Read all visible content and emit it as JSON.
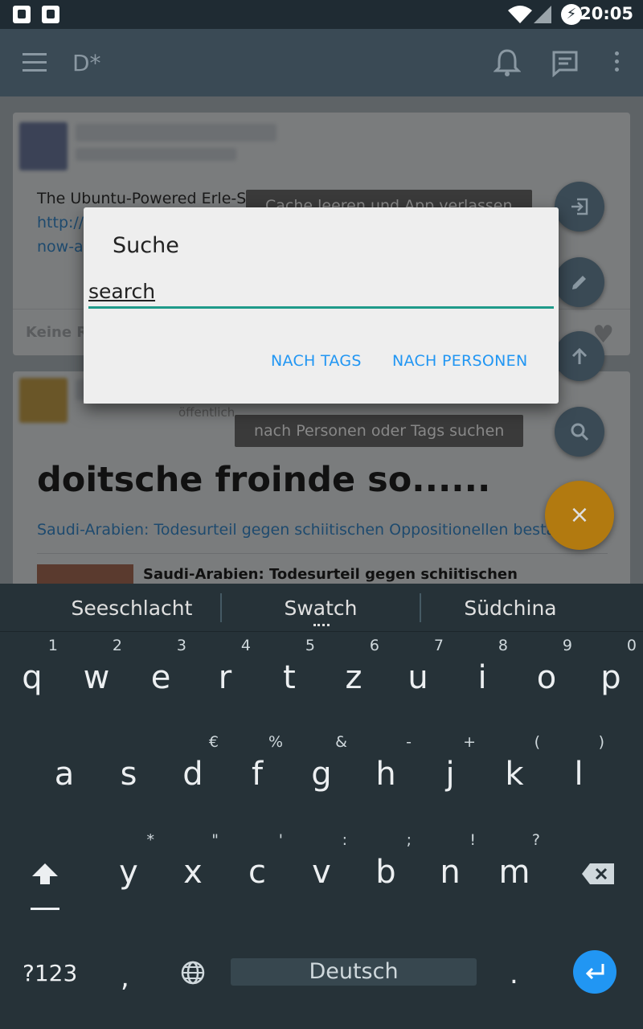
{
  "status_bar": {
    "time": "20:05"
  },
  "app_bar": {
    "title": "D*"
  },
  "feed": {
    "post1": {
      "text": "The Ubuntu-Powered Erle-Spider Drone Now Available for Sale",
      "link_line1": "http://",
      "link_line2": "now-a",
      "footer": "Keine R"
    },
    "post2": {
      "visibility": "öffentlich",
      "headline": "doitsche froinde so......",
      "link": "Saudi-Arabien: Todesurteil gegen schiitischen Oppositionellen bestä",
      "preview_title": "Saudi-Arabien: Todesurteil gegen schiitischen"
    }
  },
  "tooltips": {
    "exit": "Cache leeren und App verlassen",
    "search": "nach Personen oder Tags suchen"
  },
  "dialog": {
    "title": "Suche",
    "input_value": "search",
    "btn_tags": "NACH TAGS",
    "btn_people": "NACH PERSONEN"
  },
  "fab": {
    "close_label": "×"
  },
  "keyboard": {
    "suggestions": [
      "Seeschlacht",
      "Swatch",
      "Südchina"
    ],
    "row1": [
      {
        "k": "q",
        "h": "1"
      },
      {
        "k": "w",
        "h": "2"
      },
      {
        "k": "e",
        "h": "3"
      },
      {
        "k": "r",
        "h": "4"
      },
      {
        "k": "t",
        "h": "5"
      },
      {
        "k": "z",
        "h": "6"
      },
      {
        "k": "u",
        "h": "7"
      },
      {
        "k": "i",
        "h": "8"
      },
      {
        "k": "o",
        "h": "9"
      },
      {
        "k": "p",
        "h": "0"
      }
    ],
    "row2": [
      {
        "k": "a",
        "h": ""
      },
      {
        "k": "s",
        "h": ""
      },
      {
        "k": "d",
        "h": "€"
      },
      {
        "k": "f",
        "h": "%"
      },
      {
        "k": "g",
        "h": "&"
      },
      {
        "k": "h",
        "h": "-"
      },
      {
        "k": "j",
        "h": "+"
      },
      {
        "k": "k",
        "h": "("
      },
      {
        "k": "l",
        "h": ")"
      }
    ],
    "row3": [
      {
        "k": "y",
        "h": "*"
      },
      {
        "k": "x",
        "h": "\""
      },
      {
        "k": "c",
        "h": "'"
      },
      {
        "k": "v",
        "h": ":"
      },
      {
        "k": "b",
        "h": ";"
      },
      {
        "k": "n",
        "h": "!"
      },
      {
        "k": "m",
        "h": "?"
      }
    ],
    "symbols_label": "?123",
    "comma_label": ",",
    "space_label": "Deutsch",
    "period_label": "."
  },
  "colors": {
    "accent": "#1f9a8a",
    "button_text": "#2196f3",
    "fab_main": "#b27a10"
  }
}
